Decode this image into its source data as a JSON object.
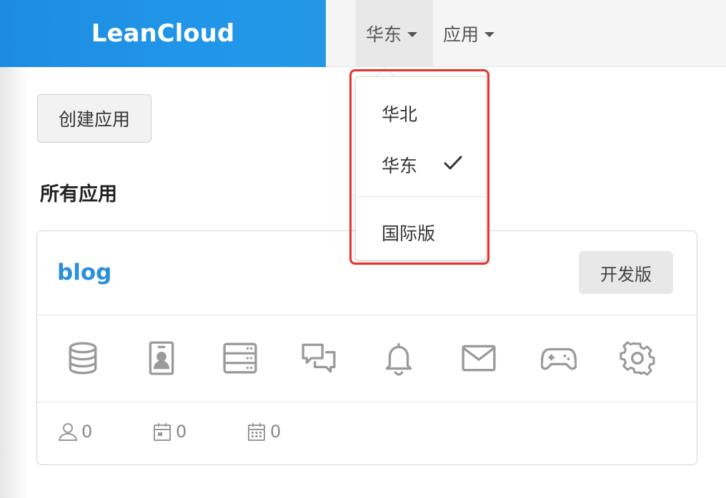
{
  "header": {
    "brand": "LeanCloud",
    "region_menu": "华东",
    "apps_menu": "应用"
  },
  "region_dropdown": {
    "items": [
      {
        "label": "华北",
        "selected": false
      },
      {
        "label": "华东",
        "selected": true
      },
      {
        "label": "国际版",
        "selected": false
      }
    ],
    "highlight_color": "#e8322a"
  },
  "main": {
    "create_button": "创建应用",
    "section_title": "所有应用",
    "apps": [
      {
        "name": "blog",
        "plan": "开发版",
        "icons": [
          "database-icon",
          "user-card-icon",
          "server-icon",
          "chat-icon",
          "bell-icon",
          "mail-icon",
          "gamepad-icon",
          "gear-icon"
        ],
        "stats": [
          {
            "icon": "user-icon",
            "value": "0"
          },
          {
            "icon": "calendar-icon",
            "value": "0"
          },
          {
            "icon": "calendar-grid-icon",
            "value": "0"
          }
        ]
      }
    ]
  },
  "colors": {
    "brand_blue": "#2196e8",
    "app_name_blue": "#2a8fdc",
    "icon_grey": "#9a9a9a"
  }
}
